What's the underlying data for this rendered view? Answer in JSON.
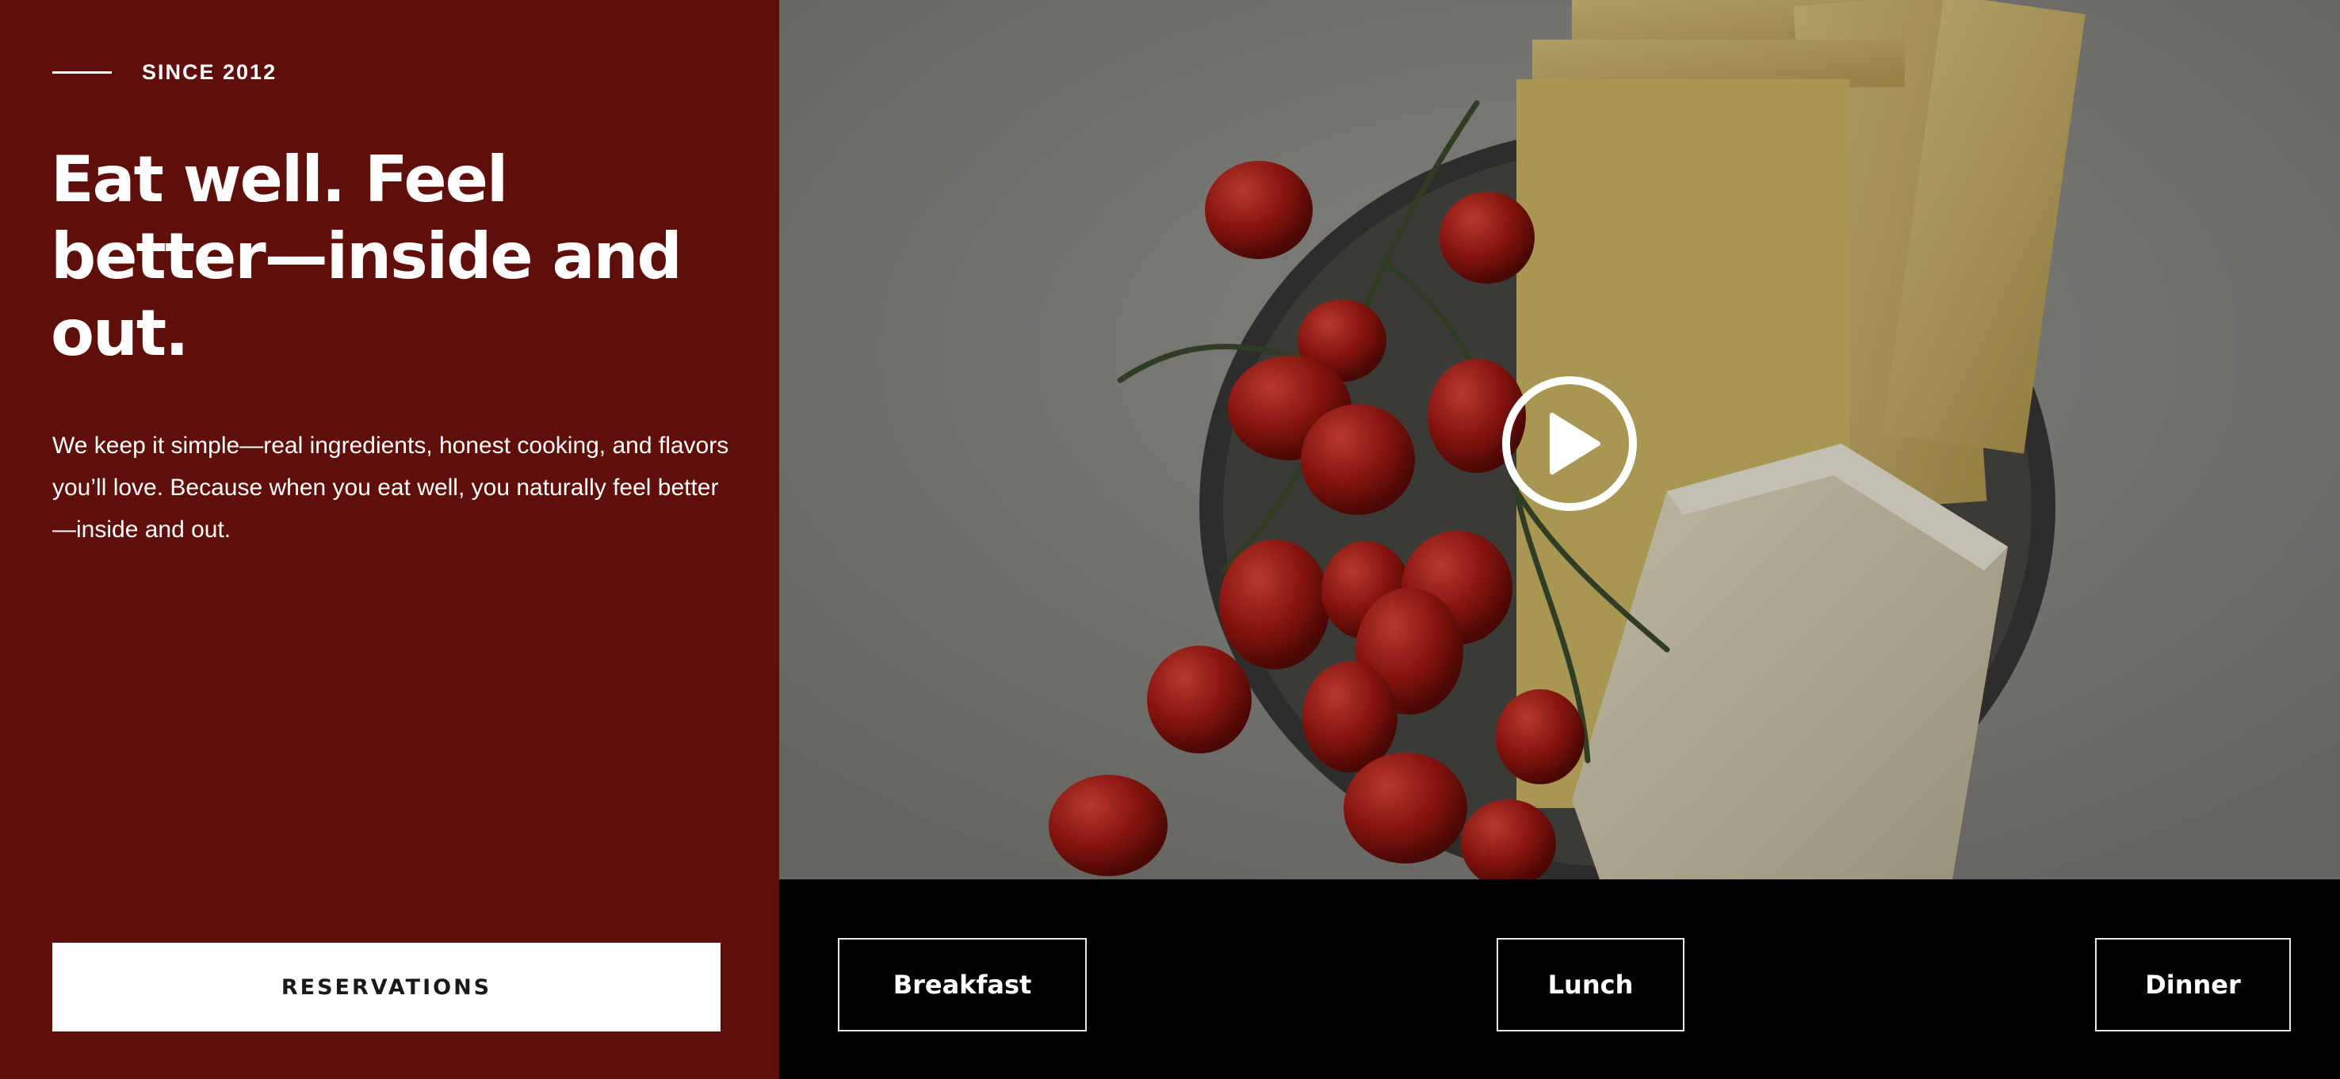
{
  "hero": {
    "eyebrow": "SINCE 2012",
    "headline": "Eat well. Feel better—inside and out.",
    "description": "We keep it simple—real ingredients, honest cooking, and flavors you’ll love. Because when you eat well, you naturally feel better—inside and out.",
    "reservations_label": "RESERVATIONS"
  },
  "media": {
    "play_icon": "play-icon"
  },
  "menu": {
    "breakfast_label": "Breakfast",
    "lunch_label": "Lunch",
    "dinner_label": "Dinner"
  },
  "colors": {
    "brand": "#5f0e09",
    "menu_bg": "#000000",
    "text": "#ffffff"
  }
}
